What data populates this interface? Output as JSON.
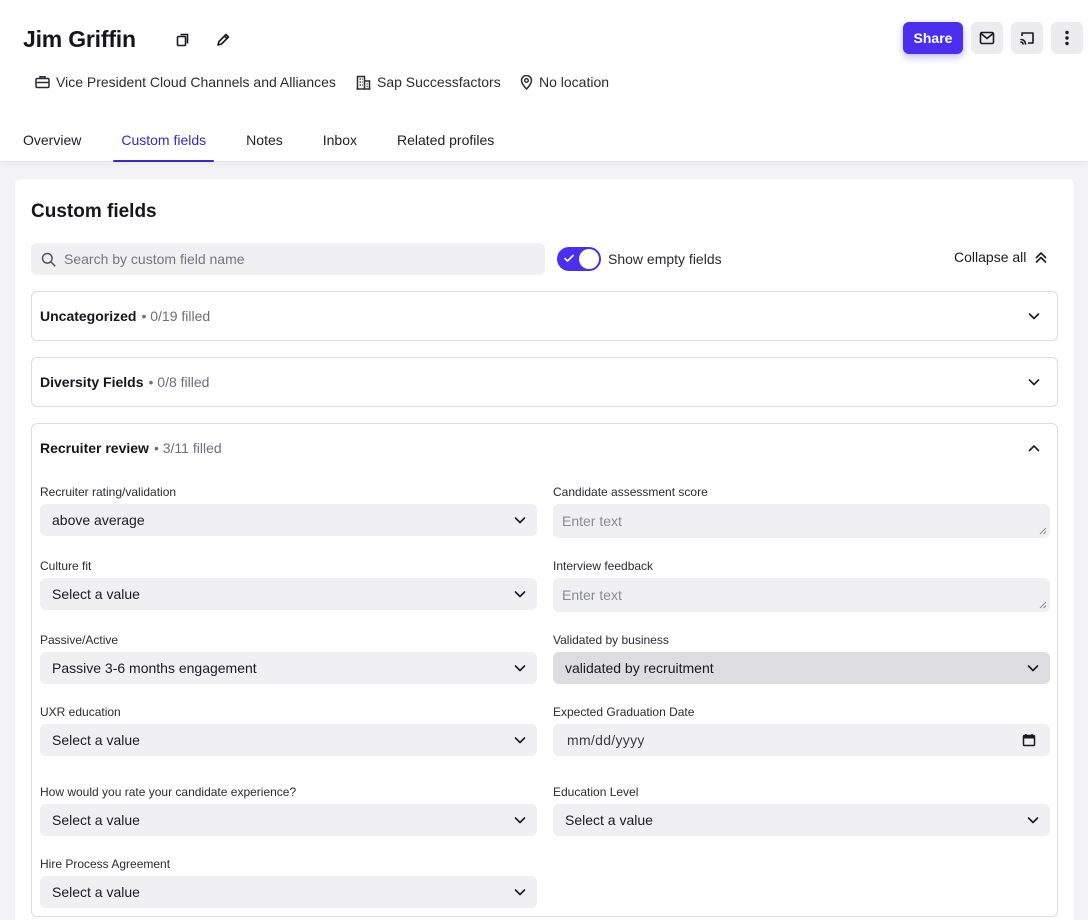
{
  "profile": {
    "name": "Jim Griffin",
    "title": "Vice President Cloud Channels and Alliances",
    "company": "Sap Successfactors",
    "location": "No location"
  },
  "actions": {
    "share_label": "Share"
  },
  "tabs": [
    {
      "label": "Overview",
      "active": false
    },
    {
      "label": "Custom fields",
      "active": true
    },
    {
      "label": "Notes",
      "active": false
    },
    {
      "label": "Inbox",
      "active": false
    },
    {
      "label": "Related profiles",
      "active": false
    }
  ],
  "custom_fields": {
    "title": "Custom fields",
    "search_placeholder": "Search by custom field name",
    "show_empty_label": "Show empty fields",
    "show_empty_on": true,
    "collapse_all_label": "Collapse all"
  },
  "sections": [
    {
      "name": "Uncategorized",
      "count": "• 0/19 filled",
      "expanded": false
    },
    {
      "name": "Diversity Fields",
      "count": "• 0/8 filled",
      "expanded": false
    },
    {
      "name": "Recruiter review",
      "count": "• 3/11 filled",
      "expanded": true
    }
  ],
  "recruiter_review": {
    "rating_label": "Recruiter rating/validation",
    "rating_value": "above average",
    "assessment_label": "Candidate assessment score",
    "assessment_placeholder": "Enter text",
    "culture_label": "Culture fit",
    "culture_value": "Select a value",
    "feedback_label": "Interview feedback",
    "feedback_placeholder": "Enter text",
    "passive_label": "Passive/Active",
    "passive_value": "Passive 3-6 months engagement",
    "validated_label": "Validated by business",
    "validated_value": "validated by recruitment",
    "uxr_label": "UXR education",
    "uxr_value": "Select a value",
    "graduation_label": "Expected Graduation Date",
    "graduation_value": "mm/dd/yyyy",
    "experience_label": "How would you rate your candidate experience?",
    "experience_value": "Select a value",
    "education_label": "Education Level",
    "education_value": "Select a value",
    "agreement_label": "Hire Process Agreement",
    "agreement_value": "Select a value"
  },
  "colors": {
    "accent": "#4b2ef0",
    "tab_active": "#3a28c9",
    "field_bg": "#f0f0f3"
  }
}
